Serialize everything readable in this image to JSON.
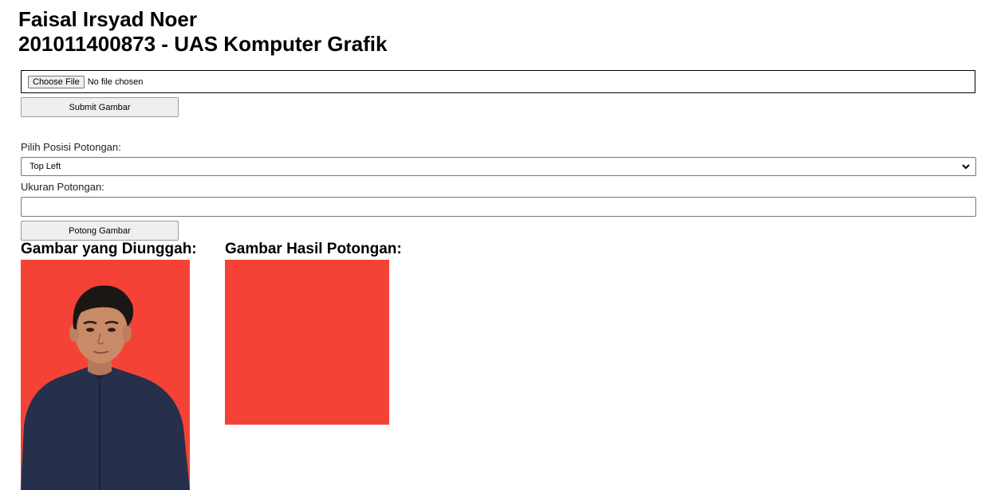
{
  "header": {
    "name": "Faisal Irsyad Noer",
    "subtitle": "201011400873 - UAS Komputer Grafik"
  },
  "upload": {
    "choose_file_label": "Choose File",
    "file_status": "No file chosen",
    "submit_label": "Submit Gambar"
  },
  "crop": {
    "position_label": "Pilih Posisi Potongan:",
    "position_selected": "Top Left",
    "size_label": "Ukuran Potongan:",
    "size_value": "",
    "crop_button_label": "Potong Gambar"
  },
  "results": {
    "uploaded_heading": "Gambar yang Diunggah:",
    "cropped_heading": "Gambar Hasil Potongan:"
  },
  "colors": {
    "photo_background": "#f44336",
    "shirt": "#26304b",
    "skin": "#c98a68",
    "hair": "#1b1714"
  },
  "icons": {
    "select_arrow": "chevron-down-icon"
  }
}
